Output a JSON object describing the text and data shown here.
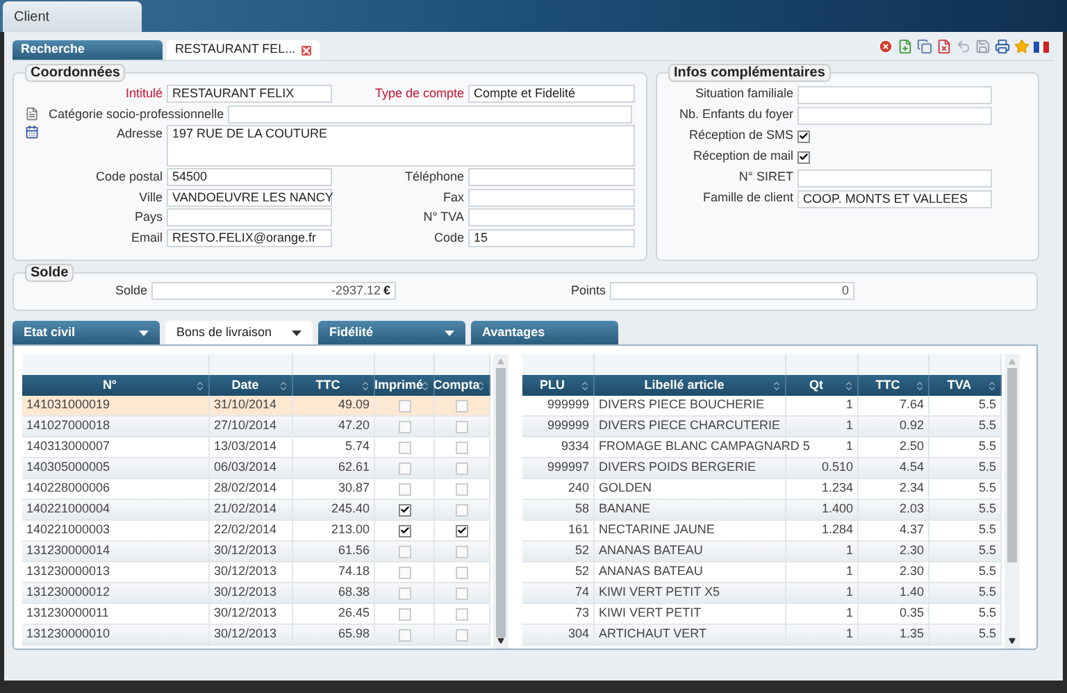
{
  "window": {
    "title": "Client"
  },
  "tabs": [
    {
      "label": "Recherche",
      "selected": false,
      "closable": false
    },
    {
      "label": "RESTAURANT FEL...",
      "selected": true,
      "closable": true
    }
  ],
  "coordonnees": {
    "title": "Coordonnées",
    "rows": [
      {
        "kind": "pair",
        "fields": [
          {
            "label": "Intitulé",
            "value": "RESTAURANT FELIX",
            "required": true
          },
          {
            "label": "Type de compte",
            "value": "Compte et Fidelité",
            "required": true
          }
        ]
      },
      {
        "kind": "wide",
        "fields": [
          {
            "label": "Catégorie socio-professionnelle",
            "required": false
          }
        ]
      },
      {
        "kind": "textarea",
        "fields": [
          {
            "label": "Adresse",
            "value": "197 RUE DE LA COUTURE",
            "required": false
          }
        ]
      },
      {
        "kind": "pair",
        "fields": [
          {
            "label": "Code postal",
            "value": "54500",
            "required": false
          },
          {
            "label": "Téléphone",
            "required": false
          }
        ]
      },
      {
        "kind": "pair",
        "fields": [
          {
            "label": "Ville",
            "value": "VANDOEUVRE LES NANCY",
            "required": false
          },
          {
            "label": "Fax",
            "required": false
          }
        ]
      },
      {
        "kind": "pair",
        "fields": [
          {
            "label": "Pays",
            "required": false
          },
          {
            "label": "N° TVA",
            "required": false
          }
        ]
      },
      {
        "kind": "pair",
        "fields": [
          {
            "label": "Email",
            "value": "RESTO.FELIX@orange.fr",
            "required": false
          },
          {
            "label": "Code",
            "value": "15",
            "required": false
          }
        ]
      }
    ]
  },
  "infos": {
    "title": "Infos complémentaires",
    "fields": [
      {
        "kind": "text",
        "label": "Situation familiale"
      },
      {
        "kind": "text",
        "label": "Nb. Enfants du foyer"
      },
      {
        "kind": "checkbox",
        "label": "Réception de SMS",
        "checked": true
      },
      {
        "kind": "checkbox",
        "label": "Réception de mail",
        "checked": true
      },
      {
        "kind": "text",
        "label": "N° SIRET"
      },
      {
        "kind": "text",
        "label": "Famille de client",
        "value": "COOP. MONTS ET VALLEES"
      }
    ]
  },
  "solde": {
    "title": "Solde",
    "fields": [
      {
        "label": "Solde",
        "value": "-2937.12",
        "unit": "€"
      },
      {
        "label": "Points",
        "value": "0"
      }
    ]
  },
  "section_tabs": [
    {
      "label": "Etat civil",
      "selected": false,
      "dropdown": true
    },
    {
      "label": "Bons de livraison",
      "selected": true,
      "dropdown": true
    },
    {
      "label": "Fidélité",
      "selected": false,
      "dropdown": true
    },
    {
      "label": "Avantages",
      "selected": false,
      "dropdown": false
    }
  ],
  "bons_table": {
    "columns": [
      {
        "label": "N°",
        "kind": "text"
      },
      {
        "label": "Date",
        "kind": "text"
      },
      {
        "label": "TTC",
        "kind": "number"
      },
      {
        "label": "Imprimé",
        "kind": "check"
      },
      {
        "label": "Compta",
        "kind": "check"
      }
    ],
    "rows": [
      {
        "selected": true,
        "cells": [
          "141031000019",
          "31/10/2014",
          "49.09"
        ],
        "imprime": false,
        "compta": false
      },
      {
        "selected": false,
        "cells": [
          "141027000018",
          "27/10/2014",
          "47.20"
        ],
        "imprime": false,
        "compta": false
      },
      {
        "selected": false,
        "cells": [
          "140313000007",
          "13/03/2014",
          "5.74"
        ],
        "imprime": false,
        "compta": false
      },
      {
        "selected": false,
        "cells": [
          "140305000005",
          "06/03/2014",
          "62.61"
        ],
        "imprime": false,
        "compta": false
      },
      {
        "selected": false,
        "cells": [
          "140228000006",
          "28/02/2014",
          "30.87"
        ],
        "imprime": false,
        "compta": false
      },
      {
        "selected": false,
        "cells": [
          "140221000004",
          "21/02/2014",
          "245.40"
        ],
        "imprime": true,
        "compta": false
      },
      {
        "selected": false,
        "cells": [
          "140221000003",
          "22/02/2014",
          "213.00"
        ],
        "imprime": true,
        "compta": true
      },
      {
        "selected": false,
        "cells": [
          "131230000014",
          "30/12/2013",
          "61.56"
        ],
        "imprime": false,
        "compta": false
      },
      {
        "selected": false,
        "cells": [
          "131230000013",
          "30/12/2013",
          "74.18"
        ],
        "imprime": false,
        "compta": false
      },
      {
        "selected": false,
        "cells": [
          "131230000012",
          "30/12/2013",
          "68.38"
        ],
        "imprime": false,
        "compta": false
      },
      {
        "selected": false,
        "cells": [
          "131230000011",
          "30/12/2013",
          "26.45"
        ],
        "imprime": false,
        "compta": false
      },
      {
        "selected": false,
        "cells": [
          "131230000010",
          "30/12/2013",
          "65.98"
        ],
        "imprime": false,
        "compta": false
      }
    ]
  },
  "articles_table": {
    "columns": [
      {
        "label": "PLU",
        "kind": "number"
      },
      {
        "label": "Libellé article",
        "kind": "text"
      },
      {
        "label": "Qt",
        "kind": "number"
      },
      {
        "label": "TTC",
        "kind": "number"
      },
      {
        "label": "TVA",
        "kind": "number"
      }
    ],
    "rows": [
      {
        "cells": [
          "999999",
          "DIVERS PIECE BOUCHERIE",
          "1",
          "7.64",
          "5.5"
        ]
      },
      {
        "cells": [
          "999999",
          "DIVERS PIECE CHARCUTERIE",
          "1",
          "0.92",
          "5.5"
        ]
      },
      {
        "cells": [
          "9334",
          "FROMAGE BLANC CAMPAGNARD 5",
          "1",
          "2.50",
          "5.5"
        ]
      },
      {
        "cells": [
          "999997",
          "DIVERS POIDS BERGERIE",
          "0.510",
          "4.54",
          "5.5"
        ]
      },
      {
        "cells": [
          "240",
          "GOLDEN",
          "1.234",
          "2.34",
          "5.5"
        ]
      },
      {
        "cells": [
          "58",
          "BANANE",
          "1.400",
          "2.03",
          "5.5"
        ]
      },
      {
        "cells": [
          "161",
          "NECTARINE JAUNE",
          "1.284",
          "4.37",
          "5.5"
        ]
      },
      {
        "cells": [
          "52",
          "ANANAS BATEAU",
          "1",
          "2.30",
          "5.5"
        ]
      },
      {
        "cells": [
          "52",
          "ANANAS BATEAU",
          "1",
          "2.30",
          "5.5"
        ]
      },
      {
        "cells": [
          "74",
          "KIWI VERT PETIT X5",
          "1",
          "1.40",
          "5.5"
        ]
      },
      {
        "cells": [
          "73",
          "KIWI VERT PETIT",
          "1",
          "0.35",
          "5.5"
        ]
      },
      {
        "cells": [
          "304",
          "ARTICHAUT VERT",
          "1",
          "1.35",
          "5.5"
        ]
      }
    ]
  }
}
